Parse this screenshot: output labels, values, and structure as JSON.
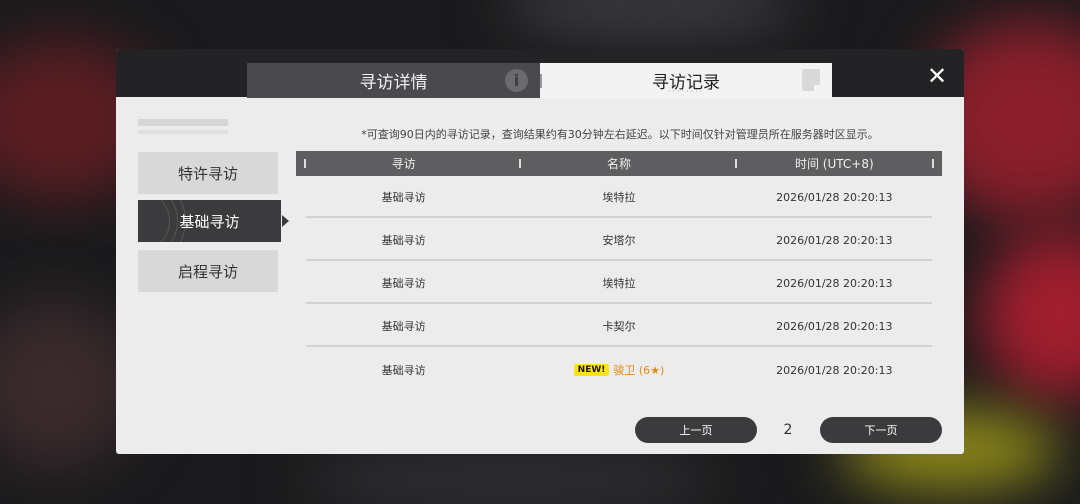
{
  "tabs": {
    "detail_label": "寻访详情",
    "detail_icon": "info-icon",
    "record_label": "寻访记录",
    "record_icon": "document-icon"
  },
  "close_icon": "close-icon",
  "menu": {
    "items": [
      {
        "label": "特许寻访",
        "active": false
      },
      {
        "label": "基础寻访",
        "active": true
      },
      {
        "label": "启程寻访",
        "active": false
      }
    ]
  },
  "notice": "*可查询90日内的寻访记录，查询结果约有30分钟左右延迟。以下时间仅针对管理员所在服务器时区显示。",
  "table": {
    "headers": [
      "寻访",
      "名称",
      "时间 (UTC+8)"
    ],
    "rows": [
      {
        "pool": "基础寻访",
        "name": "埃特拉",
        "time": "2026/01/28 20:20:13"
      },
      {
        "pool": "基础寻访",
        "name": "安塔尔",
        "time": "2026/01/28 20:20:13"
      },
      {
        "pool": "基础寻访",
        "name": "埃特拉",
        "time": "2026/01/28 20:20:13"
      },
      {
        "pool": "基础寻访",
        "name": "卡契尔",
        "time": "2026/01/28 20:20:13"
      },
      {
        "pool": "基础寻访",
        "name": "骏卫 (6★)",
        "time": "2026/01/28 20:20:13",
        "badge": "NEW!"
      }
    ]
  },
  "pager": {
    "prev_label": "上一页",
    "page": "2",
    "next_label": "下一页"
  },
  "colors": {
    "accent_dark": "#3b3b3e",
    "new_badge": "#ffe21a",
    "rare_text": "#e88a12"
  }
}
